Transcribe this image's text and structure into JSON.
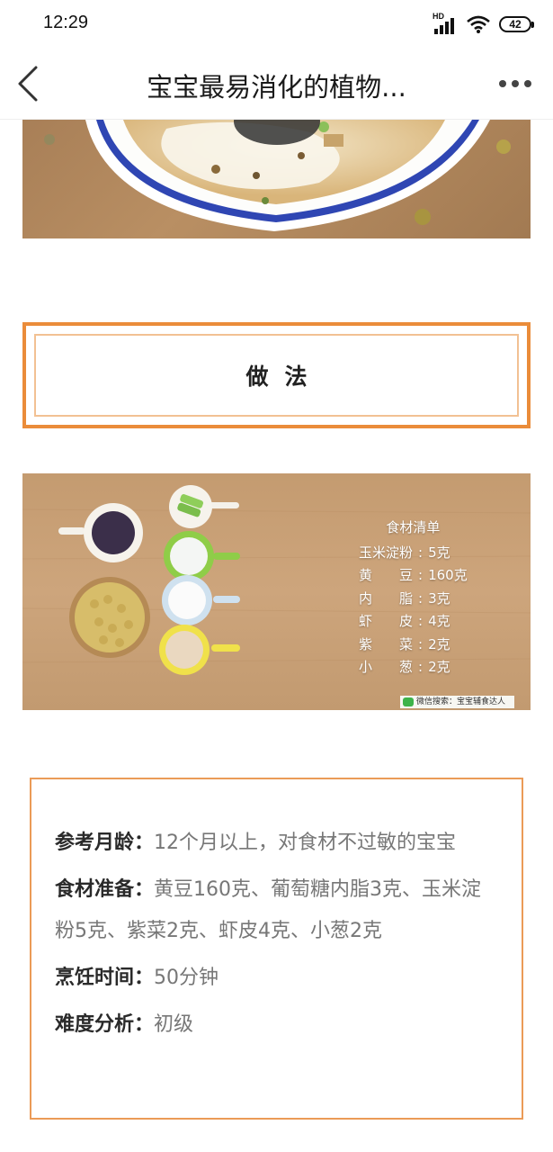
{
  "status_bar": {
    "time": "12:29",
    "network": "HD",
    "battery": "42"
  },
  "header": {
    "title": "宝宝最易消化的植物...",
    "back_icon": "chevron-left-icon",
    "more_icon": "more-dots-icon"
  },
  "section": {
    "title": "做法"
  },
  "ingredient_card": {
    "title": "食材清单",
    "items": [
      {
        "name": "玉米淀粉",
        "amount": "5克"
      },
      {
        "name": "黄　　豆",
        "amount": "160克"
      },
      {
        "name": "内　　脂",
        "amount": "3克"
      },
      {
        "name": "虾　　皮",
        "amount": "4克"
      },
      {
        "name": "紫　　菜",
        "amount": "2克"
      },
      {
        "name": "小　　葱",
        "amount": "2克"
      }
    ],
    "watermark": "微信搜索：宝宝辅食达人"
  },
  "info": {
    "age_label": "参考月龄：",
    "age_value": "12个月以上，对食材不过敏的宝宝",
    "ingredients_label": "食材准备：",
    "ingredients_value": "黄豆160克、葡萄糖内脂3克、玉米淀粉5克、紫菜2克、虾皮4克、小葱2克",
    "time_label": "烹饪时间：",
    "time_value": "50分钟",
    "difficulty_label": "难度分析：",
    "difficulty_value": "初级"
  },
  "colors": {
    "accent": "#ea8c3a",
    "accent_light": "#f2c193",
    "info_border": "#eb9b57"
  }
}
